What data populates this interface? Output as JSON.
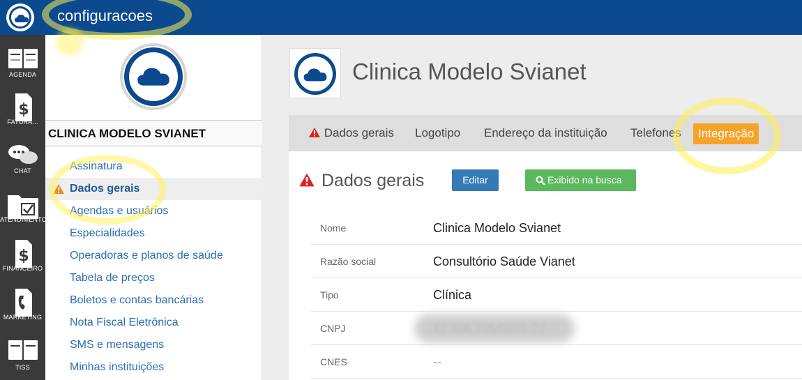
{
  "app": {
    "title": "configuracoes"
  },
  "rail": {
    "items": [
      {
        "label": "AGENDA",
        "icon": "agenda-book-icon"
      },
      {
        "label": "FATURA...",
        "icon": "dollar-document-icon"
      },
      {
        "label": "CHAT",
        "icon": "chat-bubbles-icon"
      },
      {
        "label": "ATENDIMENTO",
        "icon": "folder-check-icon"
      },
      {
        "label": "FINANCEIRO",
        "icon": "dollar-document-icon"
      },
      {
        "label": "MARKETING",
        "icon": "phone-document-icon"
      },
      {
        "label": "TISS",
        "icon": "open-book-icon"
      }
    ]
  },
  "institution": {
    "name": "CLINICA MODELO SVIANET",
    "logo_icon": "cloud-logo-icon"
  },
  "menu": {
    "items": [
      {
        "label": "Assinatura"
      },
      {
        "label": "Dados gerais",
        "active": true,
        "warning": true
      },
      {
        "label": "Agendas e usuários"
      },
      {
        "label": "Especialidades"
      },
      {
        "label": "Operadoras e planos de saúde"
      },
      {
        "label": "Tabela de preços"
      },
      {
        "label": "Boletos e contas bancárias"
      },
      {
        "label": "Nota Fiscal Eletrônica"
      },
      {
        "label": "SMS e mensagens"
      },
      {
        "label": "Minhas instituições"
      }
    ]
  },
  "header": {
    "clinic_title": "Clinica Modelo Svianet"
  },
  "tabs": [
    {
      "label": "Dados gerais",
      "warning": true
    },
    {
      "label": "Logotipo"
    },
    {
      "label": "Endereço da instituição"
    },
    {
      "label": "Telefones"
    },
    {
      "label": "Integração",
      "highlighted": true
    }
  ],
  "section": {
    "title": "Dados gerais",
    "edit_label": "Editar",
    "search_label": "Exibido na busca"
  },
  "fields": [
    {
      "key": "Nome",
      "value": "Clinica Modelo Svianet"
    },
    {
      "key": "Razão social",
      "value": "Consultório Saúde Vianet"
    },
    {
      "key": "Tipo",
      "value": "Clínica"
    },
    {
      "key": "CNPJ",
      "value": "47.406.705/0001-77"
    },
    {
      "key": "CNES",
      "value": "--"
    }
  ],
  "colors": {
    "topbar": "#0b4a8e",
    "rail": "#3a3a3a",
    "link": "#2a6fb2",
    "edit_button": "#337ab7",
    "search_button": "#5cb85c",
    "integration_tab": "#f5a32a",
    "warning": "#e02020",
    "highlighter": "#fff176"
  }
}
